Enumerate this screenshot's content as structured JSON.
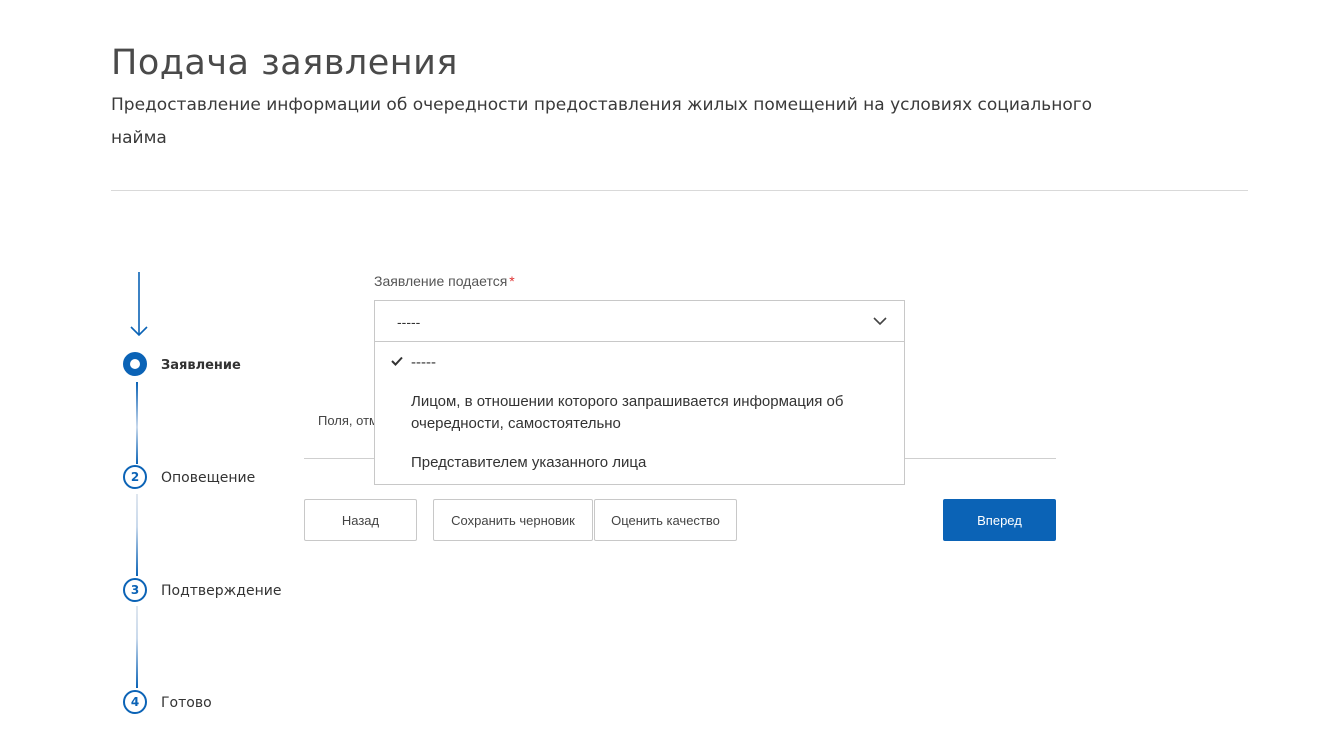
{
  "header": {
    "title": "Подача заявления",
    "subtitle": "Предоставление информации об очередности предоставления жилых помещений на условиях социального найма"
  },
  "stepper": {
    "steps": [
      {
        "number": "",
        "label": "Заявление",
        "state": "active"
      },
      {
        "number": "2",
        "label": "Оповещение",
        "state": "pending"
      },
      {
        "number": "3",
        "label": "Подтверждение",
        "state": "pending"
      },
      {
        "number": "4",
        "label": "Готово",
        "state": "pending"
      }
    ]
  },
  "form": {
    "field_label": "Заявление подается",
    "required_mark": "*",
    "select_value": "-----",
    "options": [
      {
        "label": "-----",
        "selected": true
      },
      {
        "label": "Лицом, в отношении которого запрашивается информация об очередности, самостоятельно",
        "selected": false
      },
      {
        "label": "Представителем указанного лица",
        "selected": false
      }
    ],
    "partial_note": "Поля, отм"
  },
  "buttons": {
    "back": "Назад",
    "save_draft": "Сохранить черновик",
    "rate_quality": "Оценить качество",
    "next": "Вперед"
  },
  "colors": {
    "accent": "#0b63b6",
    "required": "#e03333",
    "border": "#c8c8c8"
  },
  "icons": [
    "arrow-down-icon",
    "chevron-down-icon",
    "check-icon"
  ]
}
